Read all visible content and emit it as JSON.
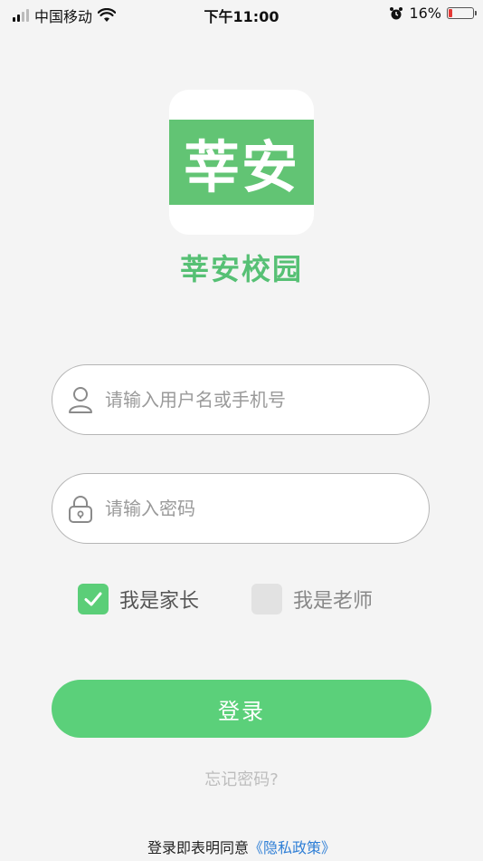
{
  "status_bar": {
    "carrier": "中国移动",
    "time": "下午11:00",
    "battery_text": "16%",
    "battery_level": 0.16,
    "icons": [
      "signal-icon",
      "wifi-icon",
      "alarm-icon",
      "battery-icon"
    ]
  },
  "logo": {
    "text": "莘安",
    "band_color": "#62c474"
  },
  "app_name": "莘安校园",
  "username": {
    "placeholder": "请输入用户名或手机号",
    "value": "",
    "icon": "user-icon"
  },
  "password": {
    "placeholder": "请输入密码",
    "value": "",
    "icon": "lock-icon"
  },
  "roles": [
    {
      "label": "我是家长",
      "checked": true
    },
    {
      "label": "我是老师",
      "checked": false
    }
  ],
  "login_button": "登录",
  "forgot_password": "忘记密码?",
  "agreement": {
    "prefix": "登录即表明同意",
    "link": "《隐私政策》"
  },
  "colors": {
    "accent": "#5bd07a",
    "app_name": "#56c074",
    "link": "#2f7fd6"
  }
}
